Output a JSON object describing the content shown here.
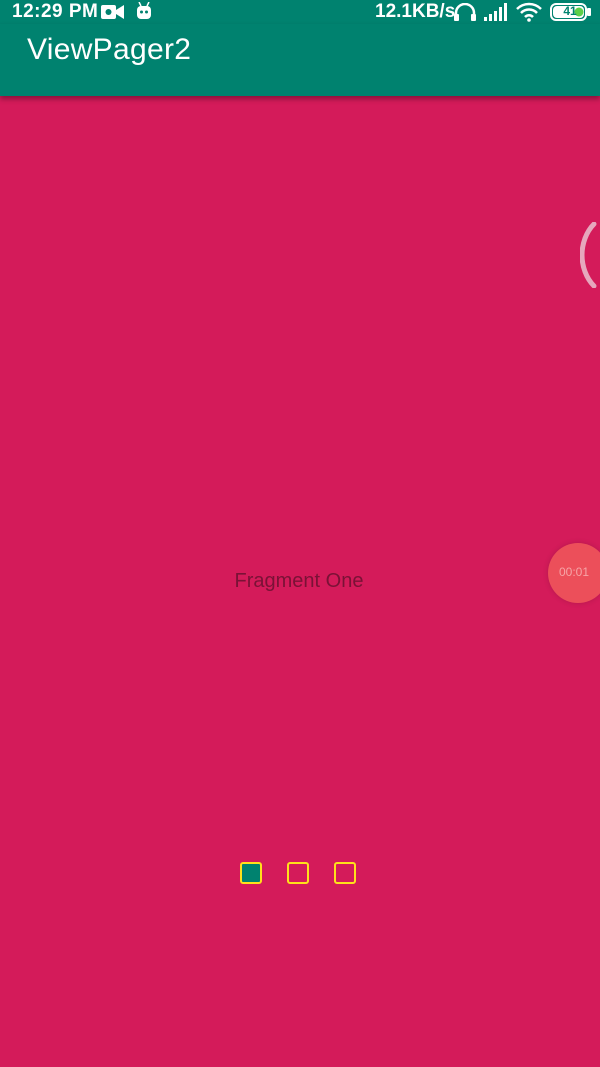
{
  "status_bar": {
    "time": "12:29 PM",
    "network_speed": "12.1KB/s",
    "battery_level": "41",
    "icons": [
      "video-camera-icon",
      "android-robot-icon",
      "headset-icon",
      "cellular-signal-icon",
      "wifi-icon",
      "battery-icon"
    ]
  },
  "app_bar": {
    "title": "ViewPager2"
  },
  "pager": {
    "current_page": 1,
    "page_count": 3,
    "fragment_label": "Fragment One"
  },
  "overlay": {
    "record_time": "00:01"
  },
  "colors": {
    "primary": "#00826f",
    "page_background": "#d41b5a",
    "indicator_border": "#ffe01b",
    "record_badge": "#ec4f5a"
  }
}
